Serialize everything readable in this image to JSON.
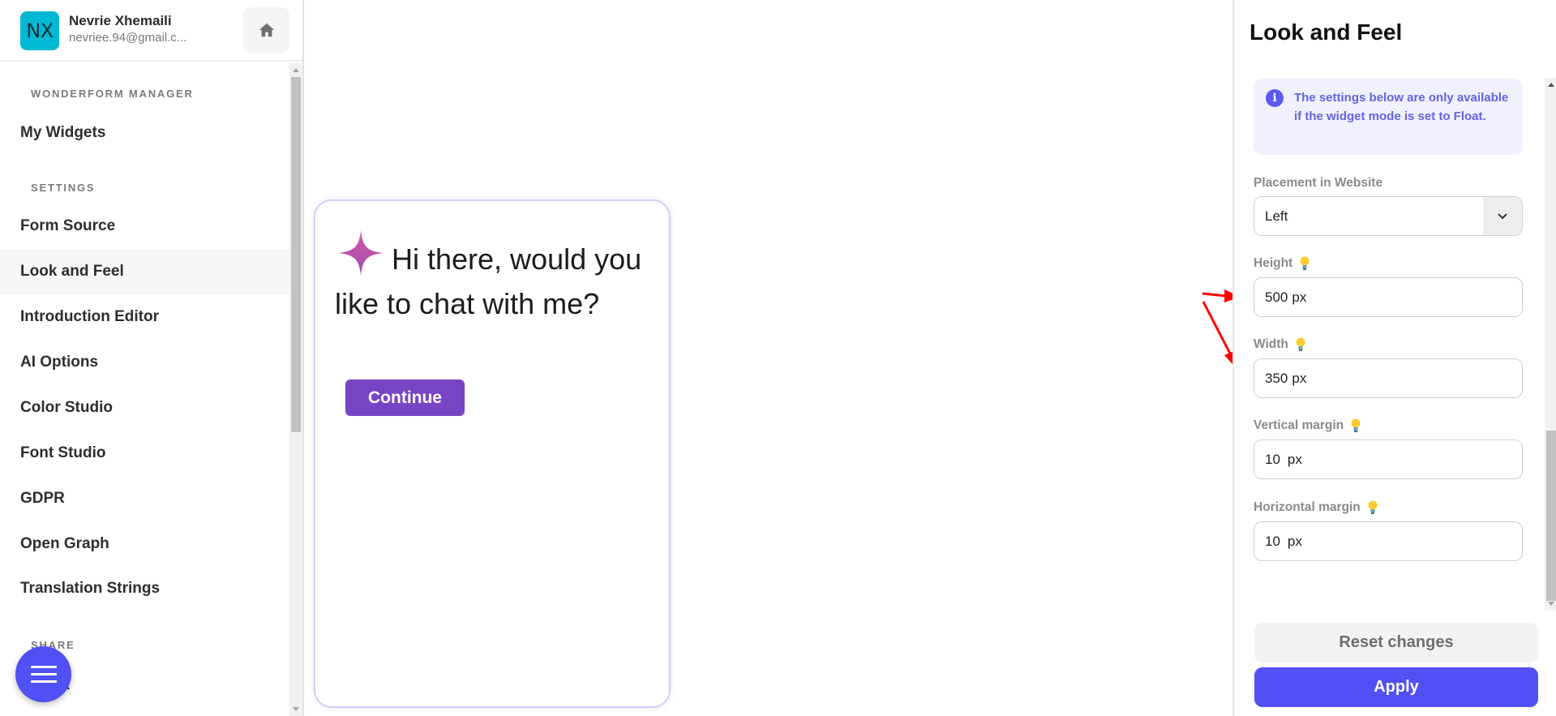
{
  "profile": {
    "initials": "NX",
    "name": "Nevrie Xhemaili",
    "email": "nevriee.94@gmail.c...",
    "avatar_color": "#00b8d4",
    "home_icon": "home-icon"
  },
  "sidebar": {
    "sections": [
      {
        "label": "WONDERFORM MANAGER"
      },
      {
        "label": "SETTINGS"
      },
      {
        "label": "SHARE"
      }
    ],
    "items": [
      {
        "label": "My Widgets"
      },
      {
        "label": "Form Source"
      },
      {
        "label": "Look and Feel",
        "active": true
      },
      {
        "label": "Introduction Editor"
      },
      {
        "label": "AI Options"
      },
      {
        "label": "Color Studio"
      },
      {
        "label": "Font Studio"
      },
      {
        "label": "GDPR"
      },
      {
        "label": "Open Graph"
      },
      {
        "label": "Translation Strings"
      },
      {
        "label": "Link"
      }
    ],
    "fab_icon": "menu-icon"
  },
  "preview": {
    "greeting": "Hi there, would you like to chat with me?",
    "continue_label": "Continue",
    "button_color": "#7745c4",
    "icon": "sparkle-icon"
  },
  "panel": {
    "title": "Look and Feel",
    "info_text": "The settings below are only available if the widget mode is set to Float.",
    "placement": {
      "label": "Placement in Website",
      "value": "Left"
    },
    "height": {
      "label": "Height",
      "value": "500",
      "unit": "px"
    },
    "width": {
      "label": "Width",
      "value": "350",
      "unit": "px"
    },
    "vertical_margin": {
      "label": "Vertical margin",
      "value": "10",
      "unit": "px"
    },
    "horizontal_margin": {
      "label": "Horizontal margin",
      "value": "10",
      "unit": "px"
    },
    "reset_label": "Reset changes",
    "apply_label": "Apply",
    "accent_color": "#5050f5"
  },
  "annotations": {
    "arrow_color": "#ff0000",
    "targets": [
      "height",
      "width"
    ]
  }
}
